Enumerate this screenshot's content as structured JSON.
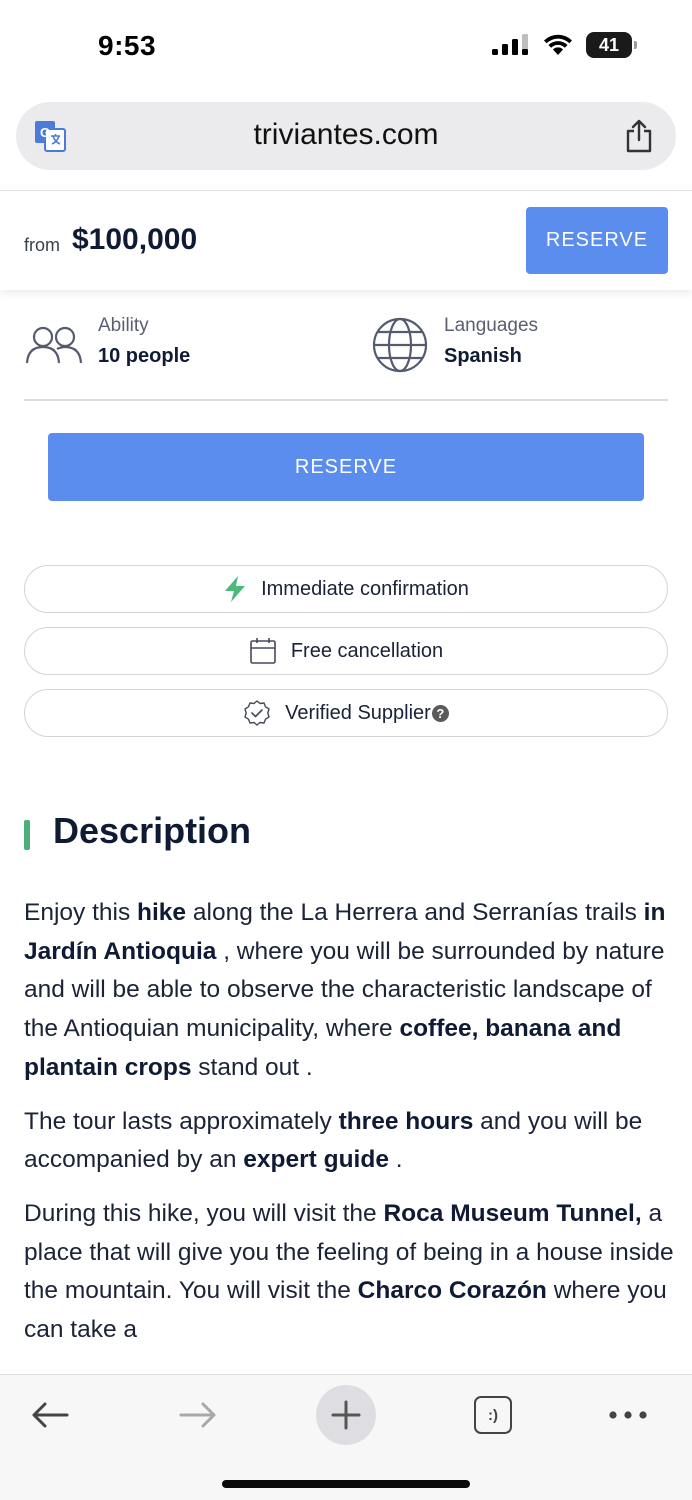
{
  "status_bar": {
    "time": "9:53",
    "battery": "41"
  },
  "browser": {
    "url": "triviantes.com"
  },
  "price_header": {
    "from_label": "from",
    "price": "$100,000",
    "reserve_label": "RESERVE"
  },
  "info": {
    "ability": {
      "label": "Ability",
      "value": "10 people"
    },
    "languages": {
      "label": "Languages",
      "value": "Spanish"
    }
  },
  "reserve_main_label": "RESERVE",
  "features": {
    "immediate": "Immediate confirmation",
    "cancellation": "Free cancellation",
    "verified": "Verified Supplier",
    "help_mark": "?"
  },
  "description": {
    "heading": "Description",
    "p1": [
      "Enjoy this ",
      "hike",
      " along the La Herrera and Serranías trails ",
      "in Jardín Antioquia",
      " , where you will be surrounded by nature and will be able to observe the characteristic landscape of the Antioquian municipality, where ",
      "coffee, banana and plantain crops",
      " stand out ."
    ],
    "p2": [
      "The tour lasts approximately ",
      "three hours",
      " and you will be accompanied by an ",
      "expert guide",
      " ."
    ],
    "p3": [
      "During this hike, you will visit the ",
      "Roca Museum Tunnel,",
      " a place that will give you the feeling of being in a house inside the mountain. You will visit the ",
      "Charco Corazón",
      " where you can take a"
    ]
  },
  "toolbar": {
    "tabs_glyph": ":)"
  },
  "colors": {
    "accent": "#5b8def",
    "green": "#4caf7a",
    "text": "#0f1b35"
  },
  "icons": [
    "translate-icon",
    "share-icon",
    "people-icon",
    "globe-icon",
    "bolt-icon",
    "calendar-icon",
    "verified-badge-icon",
    "back-arrow-icon",
    "forward-arrow-icon",
    "plus-icon",
    "tabs-icon",
    "more-icon"
  ]
}
